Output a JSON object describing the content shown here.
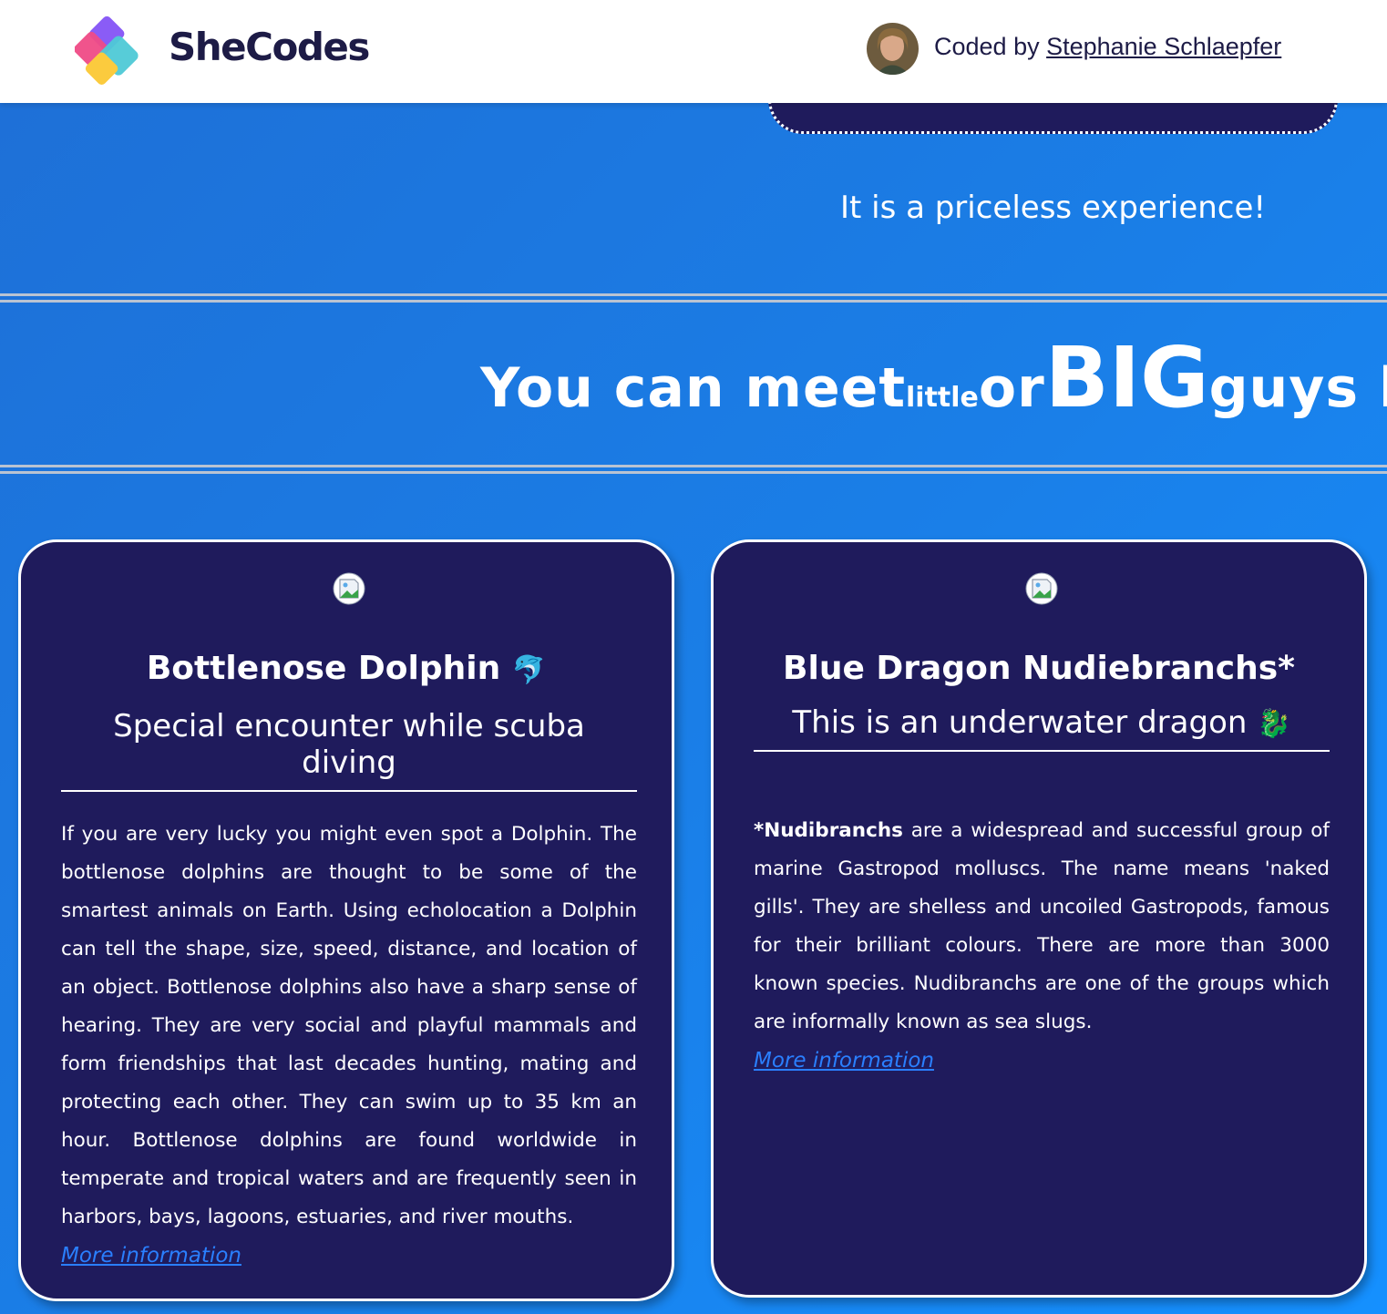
{
  "header": {
    "brand": "SheCodes",
    "credit_prefix": "Coded by ",
    "credit_name": "Stephanie Schlaepfer"
  },
  "hero": {
    "tagline": "It is a priceless experience!"
  },
  "marquee": {
    "part1": "You can meet ",
    "little": "little",
    "part2": " or ",
    "big": "BIG",
    "part3": " guys lik"
  },
  "cards": [
    {
      "title": "Bottlenose Dolphin",
      "title_emoji": "🐬",
      "subtitle": "Special encounter while scuba diving",
      "body": "If you are very lucky you might even spot a Dolphin. The bottlenose dolphins are thought to be some of the smartest animals on Earth. Using echolocation a Dolphin can tell the shape, size, speed, distance, and location of an object. Bottlenose dolphins also have a sharp sense of hearing. They are very social and playful mammals and form friendships that last decades hunting, mating and protecting each other. They can swim up to 35 km an hour. Bottlenose dolphins are found worldwide in temperate and tropical waters and are frequently seen in harbors, bays, lagoons, estuaries, and river mouths.",
      "link": "More information"
    },
    {
      "title": "Blue Dragon Nudiebranchs*",
      "subtitle": "This is an underwater dragon",
      "subtitle_emoji": "🐉",
      "body_bold": "*Nudibranchs",
      "body": " are a widespread and successful group of marine Gastropod molluscs. The name means 'naked gills'. They are shelless and uncoiled Gastropods, famous for their brilliant colours. There are more than 3000 known species. Nudibranchs are one of the groups which are informally known as sea slugs.",
      "link": "More information"
    }
  ],
  "colors": {
    "card_bg": "#1f1b5c",
    "link": "#2a7fff",
    "page_gradient_start": "#1e6fd6",
    "page_gradient_end": "#1590ff"
  },
  "icons": {
    "logo": "shecodes-logo-icon",
    "broken_image": "broken-image-icon"
  }
}
